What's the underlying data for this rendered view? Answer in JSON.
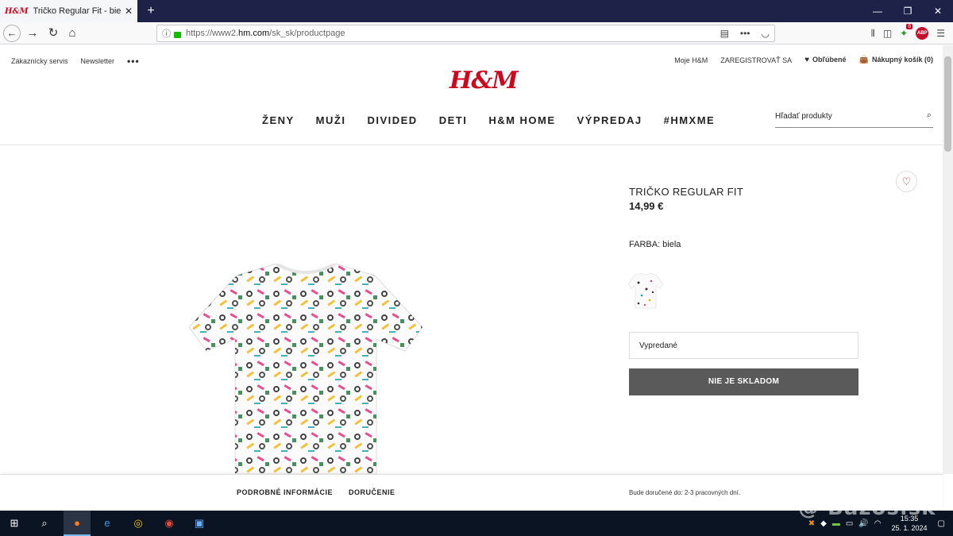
{
  "browser": {
    "tab_title": "Tričko Regular Fit - biela - MUŽI",
    "tab_favicon": "H&M",
    "new_tab": "+",
    "url_prefix": "https://www2.",
    "url_domain": "hm.com",
    "url_path": "/sk_sk/productpage",
    "ext_badge": "6",
    "abp": "ABP"
  },
  "site": {
    "util_left": [
      "Zákaznícky servis",
      "Newsletter"
    ],
    "util_more": "•••",
    "util_right": {
      "account": "Moje H&M",
      "register": "ZAREGISTROVAŤ SA",
      "favorites": "Obľúbené",
      "cart": "Nákupný košík (0)"
    },
    "logo": "H&M",
    "nav": [
      "ŽENY",
      "MUŽI",
      "DIVIDED",
      "DETI",
      "H&M HOME",
      "VÝPREDAJ",
      "#HMXME"
    ],
    "search_placeholder": "Hľadať produkty"
  },
  "product": {
    "title": "TRIČKO REGULAR FIT",
    "price": "14,99 €",
    "color_label": "FARBA: biela",
    "size_value": "Vypredané",
    "stock_button": "NIE JE SKLADOM"
  },
  "footer": {
    "tabs": [
      "PODROBNÉ INFORMÁCIE",
      "DORUČENIE"
    ],
    "delivery_note": "Bude doručené do: 2-3 pracovných dní."
  },
  "taskbar": {
    "time": "15:35",
    "date": "25. 1. 2024",
    "watermark": "@ Bazos.sk"
  },
  "colors": {
    "brand": "#cc071e",
    "button_gray": "#5a5a5a",
    "tabbar": "#1e2248"
  }
}
